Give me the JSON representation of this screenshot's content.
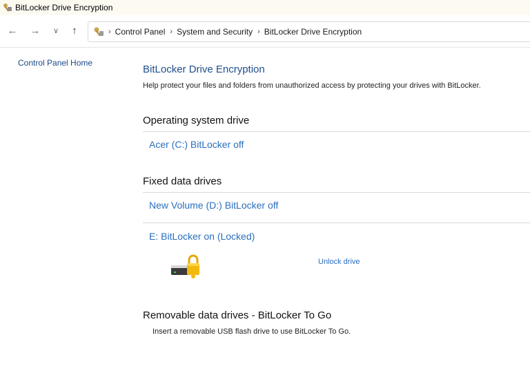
{
  "window": {
    "title": "BitLocker Drive Encryption"
  },
  "nav": {
    "back_icon": "←",
    "forward_icon": "→",
    "recent_icon": "∨",
    "up_icon": "↑"
  },
  "breadcrumb": {
    "items": [
      "Control Panel",
      "System and Security",
      "BitLocker Drive Encryption"
    ],
    "separator": "›"
  },
  "sidebar": {
    "home_label": "Control Panel Home"
  },
  "main": {
    "title": "BitLocker Drive Encryption",
    "description": "Help protect your files and folders from unauthorized access by protecting your drives with BitLocker.",
    "os_section": {
      "heading": "Operating system drive",
      "drives": [
        {
          "label": "Acer (C:) BitLocker off"
        }
      ]
    },
    "fixed_section": {
      "heading": "Fixed data drives",
      "drives": [
        {
          "label": "New Volume (D:) BitLocker off"
        },
        {
          "label": "E: BitLocker on (Locked)",
          "action": "Unlock drive"
        }
      ]
    },
    "removable_section": {
      "heading": "Removable data drives - BitLocker To Go",
      "description": "Insert a removable USB flash drive to use BitLocker To Go."
    }
  },
  "colors": {
    "link": "#2a6ebd",
    "title": "#1e4e8c",
    "lock": "#f2b90f",
    "titlebar_bg": "#fdfaf2"
  }
}
